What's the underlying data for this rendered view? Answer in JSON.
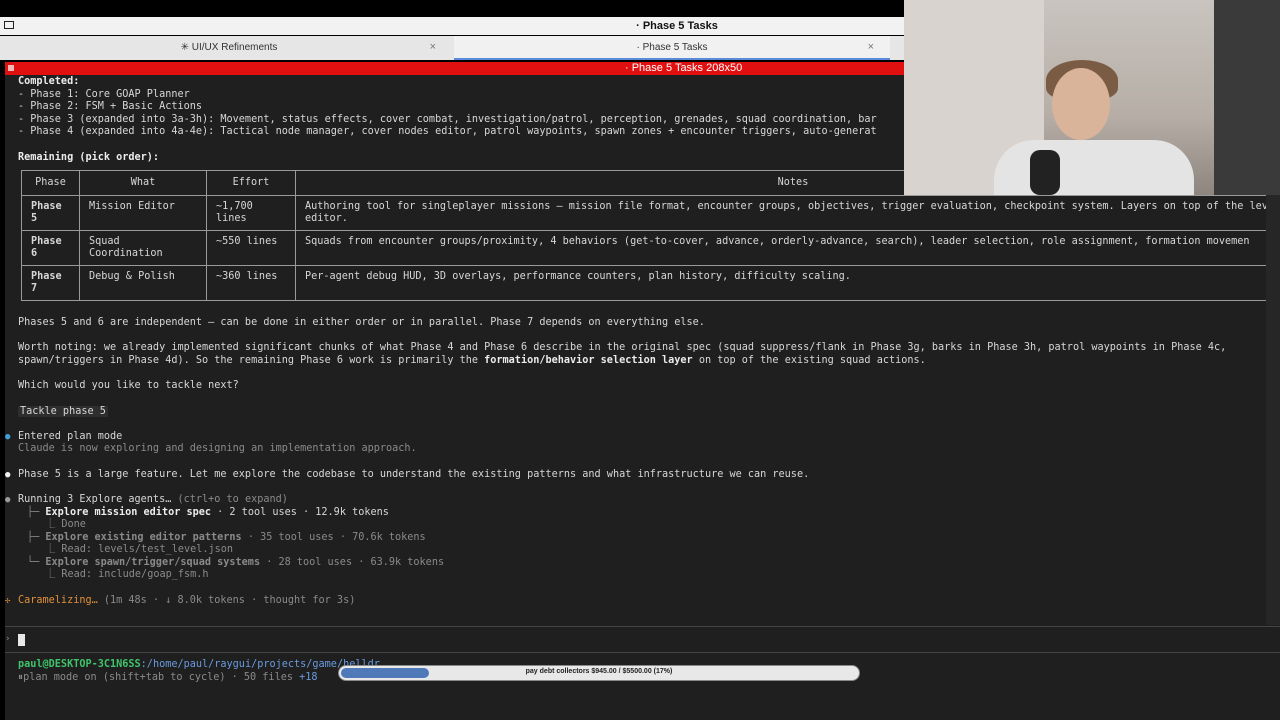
{
  "window": {
    "title": "· Phase 5 Tasks",
    "tabs": [
      {
        "label": "✳ UI/UX Refinements"
      },
      {
        "label": "· Phase 5 Tasks"
      }
    ],
    "tab_close": "×",
    "terminal_title": "· Phase 5 Tasks 208x50"
  },
  "completed": {
    "heading": "Completed:",
    "items": [
      "- Phase 1: Core GOAP Planner",
      "- Phase 2: FSM + Basic Actions",
      "- Phase 3 (expanded into 3a-3h): Movement, status effects, cover combat, investigation/patrol, perception, grenades, squad coordination, bar",
      "- Phase 4 (expanded into 4a-4e): Tactical node manager, cover nodes editor, patrol waypoints, spawn zones + encounter triggers, auto-generat"
    ]
  },
  "remaining": {
    "heading": "Remaining (pick order):",
    "columns": [
      "Phase",
      "What",
      "Effort",
      "Notes"
    ],
    "rows": [
      {
        "phase": "Phase 5",
        "what": "Mission Editor",
        "effort": "~1,700 lines",
        "notes": "Authoring tool for singleplayer missions — mission file format, encounter groups, objectives, trigger evaluation, checkpoint system. Layers on top of the level editor."
      },
      {
        "phase": "Phase 6",
        "what": "Squad Coordination",
        "effort": "~550 lines",
        "notes": "Squads from encounter groups/proximity, 4 behaviors (get-to-cover, advance, orderly-advance, search), leader selection, role assignment, formation movemen"
      },
      {
        "phase": "Phase 7",
        "what": "Debug & Polish",
        "effort": "~360 lines",
        "notes": "Per-agent debug HUD, 3D overlays, performance counters, plan history, difficulty scaling."
      }
    ]
  },
  "text": {
    "independent": "Phases 5 and 6 are independent — can be done in either order or in parallel. Phase 7 depends on everything else.",
    "worth1": "Worth noting: we already implemented significant chunks of what Phase 4 and Phase 6 describe in the original spec (squad suppress/flank in Phase 3g, barks in Phase 3h, patrol waypoints in Phase 4c,",
    "worth2a": "spawn/triggers in Phase 4d). So the remaining Phase 6 work is primarily the ",
    "worth2b": "formation/behavior selection layer",
    "worth2c": " on top of the existing squad actions.",
    "question": "Which would you like to tackle next?",
    "user_msg": "Tackle phase 5",
    "plan_mode": "Entered plan mode",
    "plan_mode_sub": "Claude is now exploring and designing an implementation approach.",
    "large_feature": "Phase 5 is a large feature. Let me explore the codebase to understand the existing patterns and what infrastructure we can reuse.",
    "running": "Running 3 Explore agents…",
    "running_hint": " (ctrl+o to expand)"
  },
  "agents": [
    {
      "name": "Explore mission editor spec",
      "stats": " · 2 tool uses · 12.9k tokens",
      "sub": "Done"
    },
    {
      "name": "Explore existing editor patterns",
      "stats": " · 35 tool uses · 70.6k tokens",
      "sub": "Read: levels/test_level.json"
    },
    {
      "name": "Explore spawn/trigger/squad systems",
      "stats": " · 28 tool uses · 63.9k tokens",
      "sub": "Read: include/goap_fsm.h"
    }
  ],
  "spinner": {
    "word": "Caramelizing…",
    "detail": " (1m 48s · ↓ 8.0k tokens · thought for 3s)"
  },
  "status": {
    "user_host": "paul@DESKTOP-3C1N6SS",
    "path": ":/home/paul/raygui/projects/game/helldr",
    "mode": "plan mode on (shift+tab to cycle) · 50 files ",
    "mode_extra": "+18"
  },
  "overlay": {
    "progress_label": "pay debt collectors $945.00 / $5500.00 (17%)",
    "progress_fraction": 0.17
  },
  "colors": {
    "accent_red": "#e01010",
    "user_green": "#3fc46b",
    "path_blue": "#6a9bde",
    "spinner_orange": "#e0913a"
  }
}
